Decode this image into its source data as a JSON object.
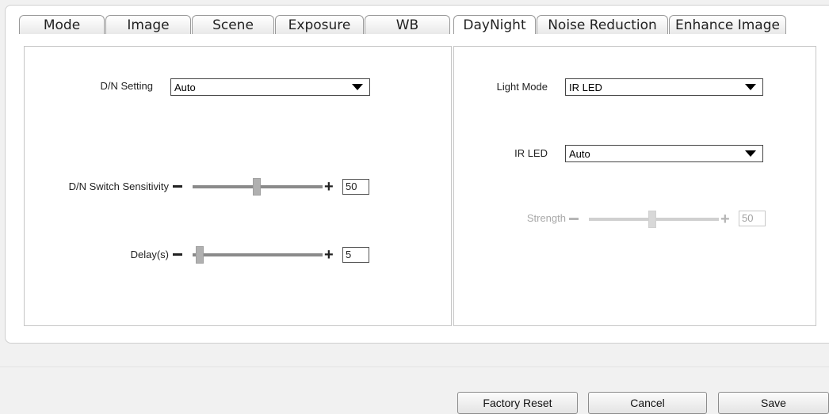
{
  "tabs": [
    {
      "label": "Mode"
    },
    {
      "label": "Image"
    },
    {
      "label": "Scene"
    },
    {
      "label": "Exposure"
    },
    {
      "label": "WB"
    },
    {
      "label": "DayNight"
    },
    {
      "label": "Noise Reduction"
    },
    {
      "label": "Enhance Image"
    }
  ],
  "active_tab": "DayNight",
  "left": {
    "dn_setting": {
      "label": "D/N Setting",
      "value": "Auto"
    },
    "dn_switch_sensitivity": {
      "label": "D/N Switch Sensitivity",
      "value": "50",
      "level": 0.5
    },
    "delay": {
      "label": "Delay(s)",
      "value": "5",
      "level": 0.05
    }
  },
  "right": {
    "light_mode": {
      "label": "Light Mode",
      "value": "IR LED"
    },
    "ir_led": {
      "label": "IR LED",
      "value": "Auto"
    },
    "strength": {
      "label": "Strength",
      "value": "50",
      "level": 0.5,
      "enabled": false
    }
  },
  "buttons": {
    "factory_reset": "Factory Reset",
    "cancel": "Cancel",
    "save": "Save"
  }
}
